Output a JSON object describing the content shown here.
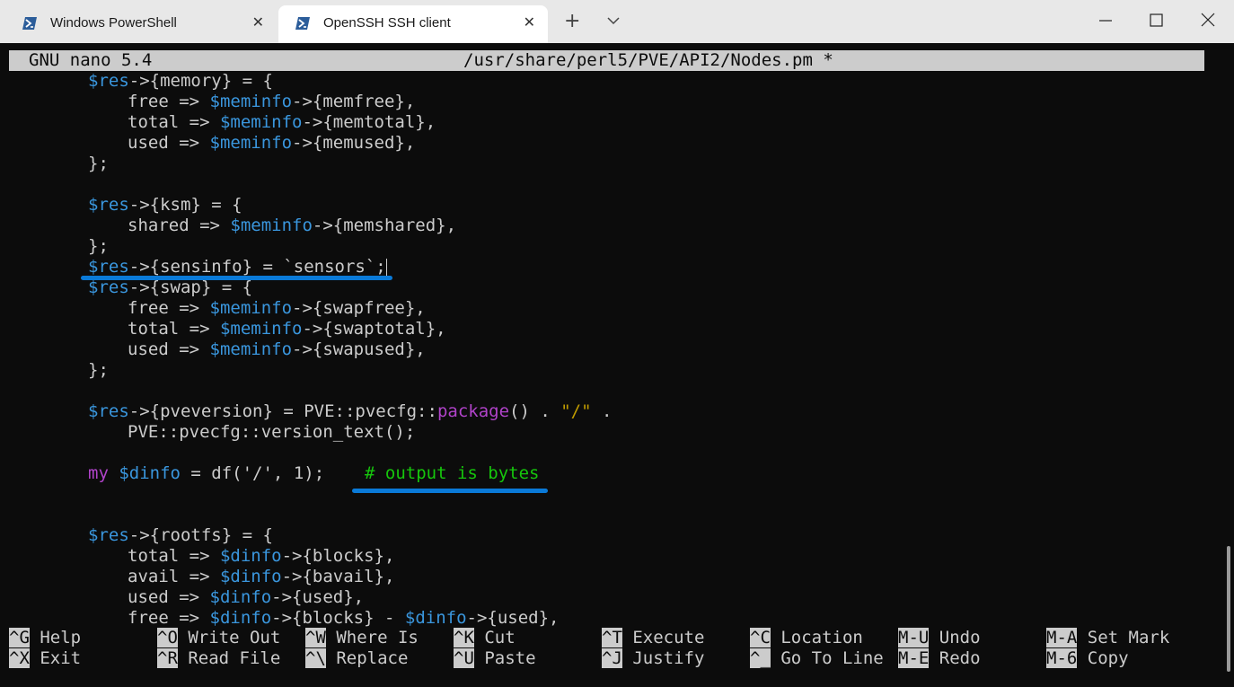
{
  "tabs": [
    {
      "label": "Windows PowerShell",
      "icon": "powershell-icon",
      "active": false
    },
    {
      "label": "OpenSSH SSH client",
      "icon": "powershell-icon",
      "active": true
    }
  ],
  "window_controls": {
    "minimize": "minimize-icon",
    "maximize": "maximize-icon",
    "close": "close-icon"
  },
  "nano": {
    "version": "GNU nano 5.4",
    "filename": "/usr/share/perl5/PVE/API2/Nodes.pm *"
  },
  "code": {
    "l1": {
      "a": "$res",
      "b": "->{memory} = {"
    },
    "l2": {
      "a": "free => ",
      "b": "$meminfo",
      "c": "->{memfree},"
    },
    "l3": {
      "a": "total => ",
      "b": "$meminfo",
      "c": "->{memtotal},"
    },
    "l4": {
      "a": "used => ",
      "b": "$meminfo",
      "c": "->{memused},"
    },
    "l5": "};",
    "l7": {
      "a": "$res",
      "b": "->{ksm} = {"
    },
    "l8": {
      "a": "shared => ",
      "b": "$meminfo",
      "c": "->{memshared},"
    },
    "l9": "};",
    "l10": {
      "a": "$res",
      "b": "->{sensinfo} = `sensors`;"
    },
    "l11": {
      "a": "$res",
      "b": "->{swap} = {"
    },
    "l12": {
      "a": "free => ",
      "b": "$meminfo",
      "c": "->{swapfree},"
    },
    "l13": {
      "a": "total => ",
      "b": "$meminfo",
      "c": "->{swaptotal},"
    },
    "l14": {
      "a": "used => ",
      "b": "$meminfo",
      "c": "->{swapused},"
    },
    "l15": "};",
    "l17": {
      "a": "$res",
      "b": "->{pveversion} = PVE::pvecfg::",
      "c": "package",
      "d": "() . ",
      "e": "\"/\"",
      "f": " ."
    },
    "l18": "PVE::pvecfg::version_text();",
    "l20": {
      "a": "my",
      "b": " ",
      "c": "$dinfo",
      "d": " = df('/', 1);",
      "e": "# output is bytes"
    },
    "l22": {
      "a": "$res",
      "b": "->{rootfs} = {"
    },
    "l23": {
      "a": "total => ",
      "b": "$dinfo",
      "c": "->{blocks},"
    },
    "l24": {
      "a": "avail => ",
      "b": "$dinfo",
      "c": "->{bavail},"
    },
    "l25": {
      "a": "used => ",
      "b": "$dinfo",
      "c": "->{used},"
    },
    "l26": {
      "a": "free => ",
      "b": "$dinfo",
      "c": "->{blocks} - ",
      "d": "$dinfo",
      "e": "->{used},"
    }
  },
  "shortcuts": {
    "row1": [
      {
        "key": "^G",
        "label": "Help"
      },
      {
        "key": "^O",
        "label": "Write Out"
      },
      {
        "key": "^W",
        "label": "Where Is"
      },
      {
        "key": "^K",
        "label": "Cut"
      },
      {
        "key": "^T",
        "label": "Execute"
      },
      {
        "key": "^C",
        "label": "Location"
      },
      {
        "key": "M-U",
        "label": "Undo"
      },
      {
        "key": "M-A",
        "label": "Set Mark"
      }
    ],
    "row2": [
      {
        "key": "^X",
        "label": "Exit"
      },
      {
        "key": "^R",
        "label": "Read File"
      },
      {
        "key": "^\\",
        "label": "Replace"
      },
      {
        "key": "^U",
        "label": "Paste"
      },
      {
        "key": "^J",
        "label": "Justify"
      },
      {
        "key": "^_",
        "label": "Go To Line"
      },
      {
        "key": "M-E",
        "label": "Redo"
      },
      {
        "key": "M-6",
        "label": "Copy"
      }
    ]
  },
  "colors": {
    "terminal_bg": "#0c0c0c",
    "text": "#cccccc",
    "variable": "#3a96dd",
    "keyword": "#b043c9",
    "string": "#c19c00",
    "comment": "#16c60c",
    "annotation_underline": "#0a7ad8"
  }
}
